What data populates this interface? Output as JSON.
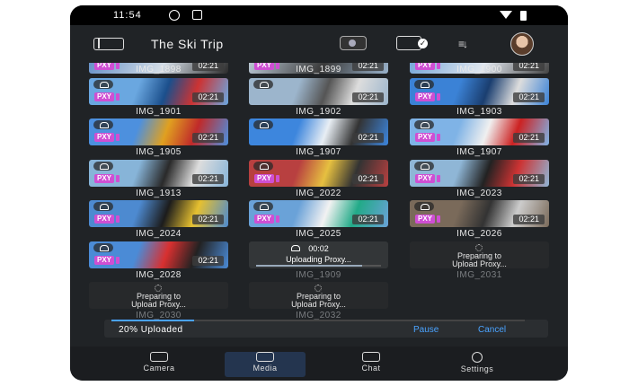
{
  "status_bar": {
    "time": "11:54"
  },
  "header": {
    "title": "The Ski Trip"
  },
  "grid": {
    "top_labels": [
      "IMG_1898",
      "IMG_1899",
      "IMG_1900"
    ],
    "top_durations": [
      "02:21",
      "02:21",
      "02:21"
    ],
    "rows": [
      [
        {
          "label": "IMG_1901",
          "duration": "02:21",
          "pxy": "PXY",
          "palette": [
            "#6aa7e0",
            "#1b4f8c",
            "#c33"
          ]
        },
        {
          "label": "IMG_1902",
          "duration": "02:21",
          "pxy": "",
          "palette": [
            "#9cb5cc",
            "#555",
            "#ddd"
          ]
        },
        {
          "label": "IMG_1903",
          "duration": "02:21",
          "pxy": "PXY",
          "palette": [
            "#3b82d6",
            "#1a3e70",
            "#ddd"
          ]
        }
      ],
      [
        {
          "label": "IMG_1905",
          "duration": "02:21",
          "pxy": "PXY",
          "palette": [
            "#4d90de",
            "#e0a020",
            "#c02a2a"
          ]
        },
        {
          "label": "IMG_1907",
          "duration": "02:21",
          "pxy": "",
          "palette": [
            "#3d86dd",
            "#e8eef4",
            "#333"
          ]
        },
        {
          "label": "IMG_1907",
          "duration": "02:21",
          "pxy": "PXY",
          "palette": [
            "#7fb3e6",
            "#f0f0f0",
            "#c22"
          ]
        }
      ],
      [
        {
          "label": "IMG_1913",
          "duration": "02:21",
          "pxy": "PXY",
          "palette": [
            "#87b4d8",
            "#2a2a2a",
            "#ddd"
          ]
        },
        {
          "label": "IMG_2022",
          "duration": "02:21",
          "pxy": "PXY",
          "palette": [
            "#b84040",
            "#e6c040",
            "#333"
          ]
        },
        {
          "label": "IMG_2023",
          "duration": "02:21",
          "pxy": "PXY",
          "palette": [
            "#8fb6d6",
            "#222",
            "#c33"
          ]
        }
      ],
      [
        {
          "label": "IMG_2024",
          "duration": "02:21",
          "pxy": "PXY",
          "palette": [
            "#4d8ad0",
            "#1c1c1c",
            "#e6c030"
          ]
        },
        {
          "label": "IMG_2025",
          "duration": "02:21",
          "pxy": "PXY",
          "palette": [
            "#6aa2d8",
            "#f2f2f2",
            "#2a8"
          ]
        },
        {
          "label": "IMG_2026",
          "duration": "02:21",
          "pxy": "PXY",
          "palette": [
            "#7a6a5a",
            "#333",
            "#ccc"
          ]
        }
      ]
    ],
    "row5": {
      "tile1": {
        "label": "IMG_2028",
        "duration": "02:21",
        "pxy": "PXY",
        "palette": [
          "#4b8bd6",
          "#d83030",
          "#222"
        ]
      },
      "uploading": {
        "time": "00:02",
        "text": "Uploading Proxy...",
        "label": "IMG_1909",
        "progress": 0.85
      },
      "preparing1": {
        "text1": "Preparing to",
        "text2": "Upload Proxy...",
        "label": "IMG_2031"
      }
    },
    "row6": {
      "preparing2": {
        "text1": "Preparing to",
        "text2": "Upload Proxy...",
        "label": "IMG_2030"
      },
      "preparing3": {
        "text1": "Preparing to",
        "text2": "Upload Proxy...",
        "label": "IMG_2032"
      }
    }
  },
  "upload_status": {
    "text": "20% Uploaded",
    "progress": 0.2,
    "pause_label": "Pause",
    "cancel_label": "Cancel"
  },
  "nav": {
    "camera": "Camera",
    "media": "Media",
    "chat": "Chat",
    "settings": "Settings"
  },
  "colors": {
    "accent": "#4aa3ff",
    "pxy_badge": "#cf4fd3",
    "background": "#202326"
  }
}
